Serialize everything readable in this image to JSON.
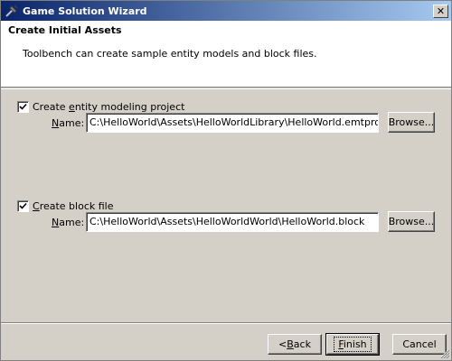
{
  "window": {
    "title": "Game Solution Wizard",
    "close_glyph": "✕"
  },
  "header": {
    "title": "Create Initial Assets",
    "description": "Toolbench can create sample entity models and block files."
  },
  "entity_project": {
    "checkbox_label_pre": "Create ",
    "checkbox_label_ul": "e",
    "checkbox_label_post": "ntity modeling project",
    "checked": true,
    "name_label_ul": "N",
    "name_label_post": "ame:",
    "value": "C:\\HelloWorld\\Assets\\HelloWorldLibrary\\HelloWorld.emtproj",
    "browse_label": "Browse..."
  },
  "block_file": {
    "checkbox_label_pre": "",
    "checkbox_label_ul": "C",
    "checkbox_label_post": "reate block file",
    "checked": true,
    "name_label_ul": "N",
    "name_label_post": "ame:",
    "value": "C:\\HelloWorld\\Assets\\HelloWorldWorld\\HelloWorld.block",
    "browse_label": "Browse..."
  },
  "footer": {
    "back_pre": "< ",
    "back_ul": "B",
    "back_post": "ack",
    "finish_ul": "F",
    "finish_post": "inish",
    "cancel_label": "Cancel"
  }
}
